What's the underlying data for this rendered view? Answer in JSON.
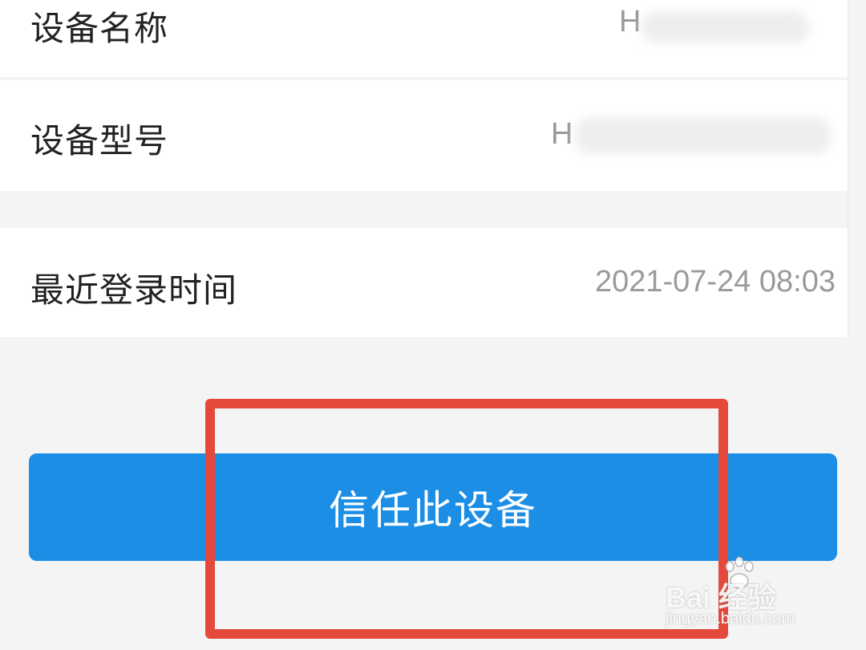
{
  "device_info": {
    "name_label": "设备名称",
    "name_value": "H",
    "model_label": "设备型号",
    "model_value": "H",
    "last_login_label": "最近登录时间",
    "last_login_value": "2021-07-24 08:03"
  },
  "actions": {
    "trust_button_label": "信任此设备"
  },
  "watermark": {
    "brand": "Bai 经验",
    "site": "jingyan.baidu.com"
  },
  "colors": {
    "primary_button": "#1c8ee6",
    "highlight_border": "#e5493b",
    "page_background": "#f4f4f4"
  }
}
